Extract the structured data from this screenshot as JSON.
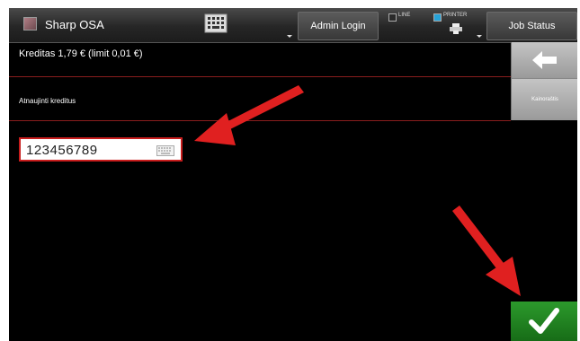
{
  "header": {
    "app_title": "Sharp OSA",
    "admin_login_label": "Admin Login",
    "line_label": "LINE",
    "printer_label": "PRINTER",
    "job_status_label": "Job Status"
  },
  "credit": {
    "text": "Kreditas 1,79 € (limit 0,01 €)"
  },
  "refresh": {
    "label": "Atnaujinti kreditus",
    "pricelist_label": "Kainoraštis"
  },
  "input": {
    "value": "123456789"
  },
  "colors": {
    "screen_bg": "#000000",
    "divider": "#8a1d1d",
    "input_border": "#c81d1d",
    "ok_green": "#1f861f",
    "annotation_arrow": "#e02020",
    "printer_indicator": "#27a3d8"
  },
  "icons": {
    "app": "app-icon",
    "keyboard": "keyboard-icon",
    "printer": "printer-icon",
    "back": "back-arrow-icon",
    "ok": "checkmark-icon"
  }
}
